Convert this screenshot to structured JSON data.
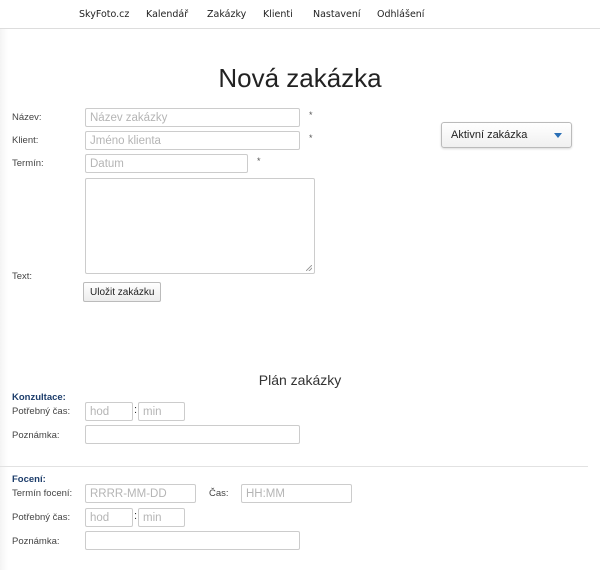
{
  "nav": {
    "brand": "SkyFoto.cz",
    "items": [
      "Kalendář",
      "Zakázky",
      "Klienti",
      "Nastavení",
      "Odhlášení"
    ]
  },
  "page": {
    "title": "Nová zakázka"
  },
  "form": {
    "name": {
      "label": "Název:",
      "placeholder": "Název zakázky",
      "required": "*"
    },
    "client": {
      "label": "Klient:",
      "placeholder": "Jméno klienta",
      "required": "*"
    },
    "term": {
      "label": "Termín:",
      "placeholder": "Datum",
      "required": "*"
    },
    "text": {
      "label": "Text:"
    },
    "save_label": "Uložit zakázku"
  },
  "status_select": {
    "value": "Aktivní zakázka"
  },
  "plan": {
    "title": "Plán zakázky",
    "consultation": {
      "heading": "Konzultace:",
      "time_label": "Potřebný čas:",
      "hours_placeholder": "hod",
      "colon": ":",
      "minutes_placeholder": "min",
      "note_label": "Poznámka:"
    },
    "photo": {
      "heading": "Focení:",
      "date_label": "Termín focení:",
      "date_placeholder": "RRRR-MM-DD",
      "time_of_day_label": "Čas:",
      "time_of_day_placeholder": "HH:MM",
      "time_label": "Potřebný čas:",
      "hours_placeholder": "hod",
      "colon": ":",
      "minutes_placeholder": "min",
      "note_label": "Poznámka:"
    }
  },
  "colors": {
    "accent": "#2a6fb6",
    "heading": "#1d3d6b"
  }
}
